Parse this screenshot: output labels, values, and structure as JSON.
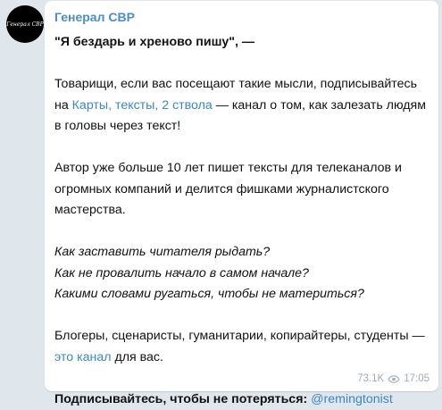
{
  "channel": {
    "avatar_text": "Генерал СВР",
    "name": "Генерал СВР"
  },
  "message": {
    "line1": "\"Я бездарь и хреново пишу\", —",
    "p2_a": "Товарищи, если вас посещают такие мысли, подписывайтесь на ",
    "p2_link": "Карты, тексты, 2 ствола",
    "p2_b": " — канал о том, как залезать людям в головы через текст!",
    "p3": "Автор уже больше 10 лет пишет тексты для телеканалов и огромных компаний и делится фишками журналистского мастерства.",
    "q1": "Как заставить читателя рыдать?",
    "q2": "Как не провалить начало в самом начале?",
    "q3": "Какими словами ругаться, чтобы не материться?",
    "p5_a": "Блогеры, сценаристы, гуманитарии, копирайтеры, студенты — ",
    "p5_link": "это канал",
    "p5_b": " для вас.",
    "p6_bold": "Подписывайтесь, чтобы не потеряться:",
    "p6_link": "@remingtonist"
  },
  "footer": {
    "views": "73.1K",
    "views_icon": "eye-icon",
    "time": "17:05"
  },
  "colors": {
    "background": "#dfe6ec",
    "channel_name": "#4a8ec8",
    "link": "#3b88c3",
    "meta": "#a0acb6"
  }
}
